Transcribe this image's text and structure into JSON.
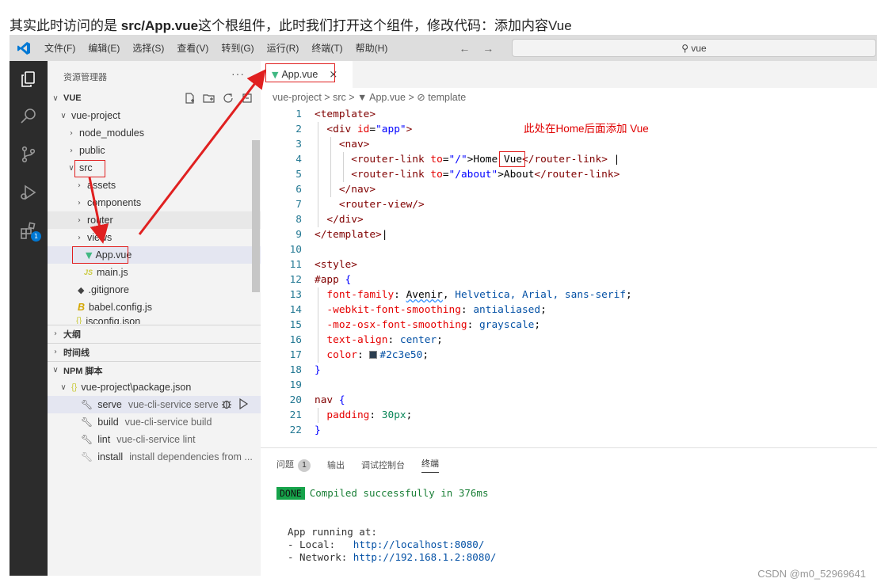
{
  "caption": {
    "pre": "其实此时访问的是 ",
    "bold": "src/App.vue",
    "post": "这个根组件，此时我们打开这个组件，修改代码：添加内容Vue"
  },
  "menu": [
    "文件(F)",
    "编辑(E)",
    "选择(S)",
    "查看(V)",
    "转到(G)",
    "运行(R)",
    "终端(T)",
    "帮助(H)"
  ],
  "nav_arrows": "← →",
  "search": "⚲ vue",
  "activity": {
    "badge": "1"
  },
  "explorer": {
    "title": "资源管理器",
    "dots": "···",
    "root": "VUE",
    "items": [
      "vue-project",
      "node_modules",
      "public",
      "src",
      "assets",
      "components",
      "router",
      "views",
      "App.vue",
      "main.js",
      ".gitignore",
      "babel.config.js",
      "jsconfig.json"
    ],
    "js_icon": "JS",
    "babel_icon": "B",
    "json_icon": "{}"
  },
  "sections": {
    "outline": "大纲",
    "timeline": "时间线",
    "npm": "NPM 脚本"
  },
  "npm": {
    "package": "vue-project\\package.json",
    "scripts": [
      {
        "name": "serve",
        "cmd": "vue-cli-service serve"
      },
      {
        "name": "build",
        "cmd": "vue-cli-service build"
      },
      {
        "name": "lint",
        "cmd": "vue-cli-service lint"
      },
      {
        "name": "install",
        "cmd": "install dependencies from ..."
      }
    ]
  },
  "tab": {
    "label": "App.vue",
    "close": "×"
  },
  "breadcrumb": "vue-project > src > ▼ App.vue > ⊘ template",
  "code": {
    "l1_tag": "<template>",
    "l2_open": "<div ",
    "l2_attr": "id",
    "l2_val": "\"app\"",
    "l2_close": ">",
    "l3": "<nav>",
    "l4_open": "<router-link ",
    "l4_attr": "to",
    "l4_val": "\"/\"",
    "l4_text": ">Home ",
    "l4_vue": "Vue",
    "l4_close": "</router-link>",
    "l4_bar": " |",
    "l5_open": "<router-link ",
    "l5_attr": "to",
    "l5_val": "\"/about\"",
    "l5_text": ">About",
    "l5_close": "</router-link>",
    "l6": "</nav>",
    "l7": "<router-view/>",
    "l8": "</div>",
    "l9": "</template>",
    "l11": "<style>",
    "l12_sel": "#app",
    "l12_brace": " {",
    "l13_prop": "font-family",
    "l13_v1": "Avenir",
    "l13_rest": "Helvetica, Arial, sans-serif",
    "l14_prop": "-webkit-font-smoothing",
    "l14_val": "antialiased",
    "l15_prop": "-moz-osx-font-smoothing",
    "l15_val": "grayscale",
    "l16_prop": "text-align",
    "l16_val": "center",
    "l17_prop": "color",
    "l17_val": "#2c3e50",
    "l18": "}",
    "l20_sel": "nav",
    "l20_brace": " {",
    "l21_prop": "padding",
    "l21_val": "30px",
    "l22": "}"
  },
  "annotation_note": "此处在Home后面添加 Vue",
  "panel": {
    "tabs": [
      "问题",
      "输出",
      "调试控制台",
      "终端"
    ],
    "problems_count": "1",
    "done": "DONE",
    "compiled": "Compiled successfully in 376ms",
    "running": "App running at:",
    "local_label": "- Local:   ",
    "local_url": "http://localhost:8080/",
    "network_label": "- Network: ",
    "network_url": "http://192.168.1.2:8080/"
  },
  "watermark": "CSDN @m0_52969641",
  "colors": {
    "accent": "#0078d4",
    "annotation": "#e02020",
    "vue_green": "#41b883",
    "done_green": "#16a34a"
  }
}
